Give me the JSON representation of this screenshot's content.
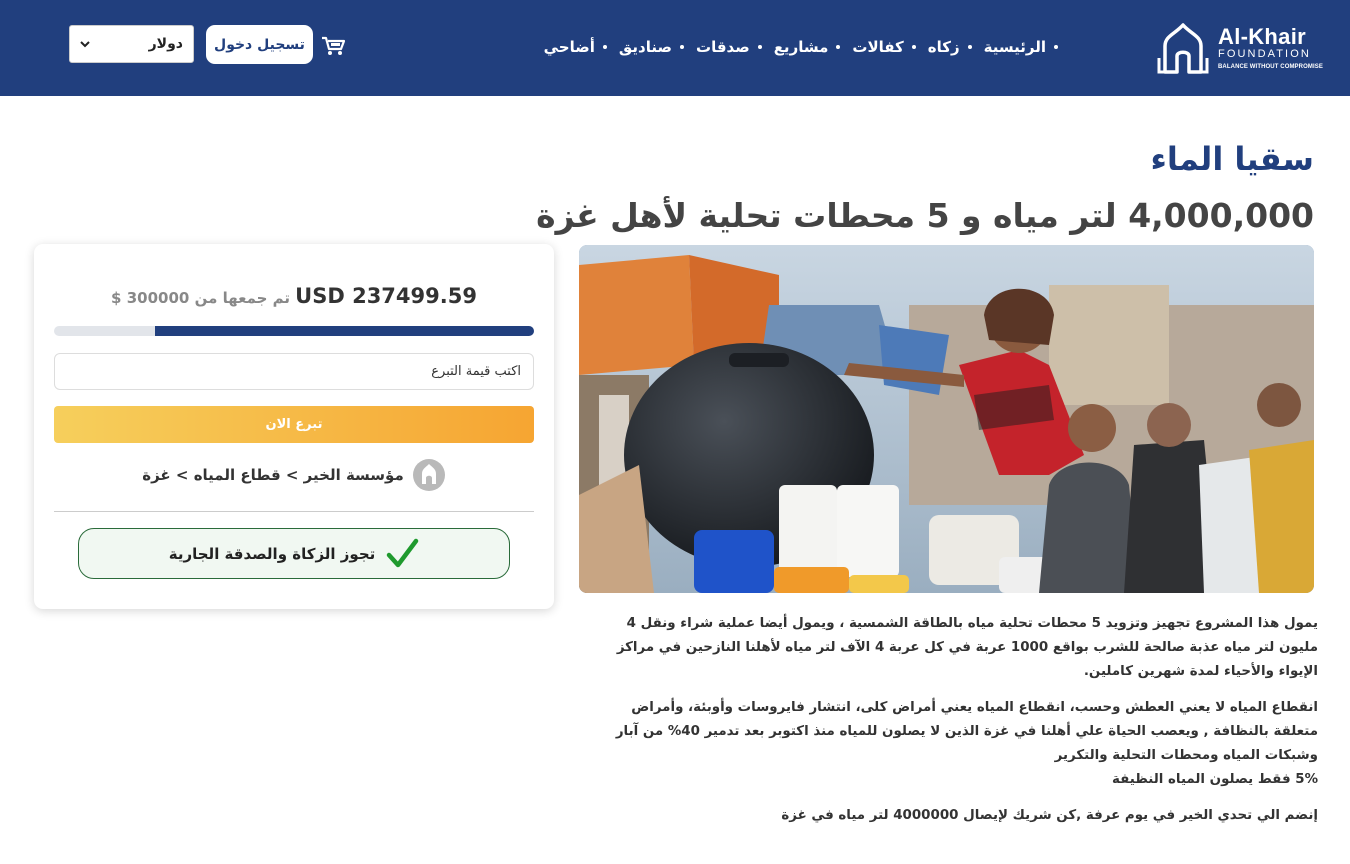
{
  "header": {
    "brand_name": "Al-Khair",
    "brand_sub": "FOUNDATION",
    "brand_tagline": "BALANCE WITHOUT COMPROMISE",
    "nav": [
      "الرئيسية",
      "زكاه",
      "كفالات",
      "مشاريع",
      "صدقات",
      "صناديق",
      "أضاحي"
    ],
    "login_label": "تسجيل دخول",
    "currency_selected": "دولار",
    "colors": {
      "bg": "#213f7e",
      "text": "#ffffff"
    },
    "icons": [
      "logo-dome-icon",
      "cart-icon",
      "chevron-down-icon"
    ]
  },
  "page": {
    "title": "سقيا الماء",
    "subtitle": "4,000,000 لتر مياه و 5 محطات تحلية لأهل غزة"
  },
  "donation": {
    "raised_amount": "USD 237499.59",
    "goal_text": "تم جمعها من 300000 $",
    "progress_fraction": 0.79,
    "input_placeholder": "اكتب قيمة التبرع",
    "donate_label": "تبرع الان",
    "breadcrumb": "مؤسسة الخير > قطاع المياه > غزة",
    "zakat_text": "تجوز الزكاة والصدقة الجارية",
    "colors": {
      "progress": "#213f7e",
      "track": "#e2e5ea",
      "button_start": "#f6cf5c",
      "button_end": "#f6a532",
      "check": "#1f9a2e"
    }
  },
  "description": {
    "p1": "يمول هذا المشروع تجهيز وتزويد 5 محطات تحلية مياه بالطاقة الشمسية ، ويمول أيضا عملية شراء ونقل  4 مليون لتر مياه عذبة صالحة للشرب بواقع 1000 عربة في كل عربة 4 الآف لتر مياه لأهلنا النازحين في مراكز الإيواء والأحياء لمدة شهرين كاملين.",
    "p2_lines": [
      "انقطاع المياه لا يعني العطش وحسب، انقطاع المياه يعني أمراض كلى، انتشار فايروسات وأوبئة، وأمراض متعلقة بالنظافة , ويعصب الحياة علي أهلنا في غزة الذين لا يصلون للمياه منذ اكتوبر بعد تدمير 40% من آبار وشبكات المياه ومحطات التحلية والتكرير",
      "5% فقط يصلون المياه النظيفة"
    ],
    "p3": "إنضم الي تحدي الخير في يوم عرفة ,كن شريك لإيصال 4000000 لتر مياه في غزة"
  }
}
